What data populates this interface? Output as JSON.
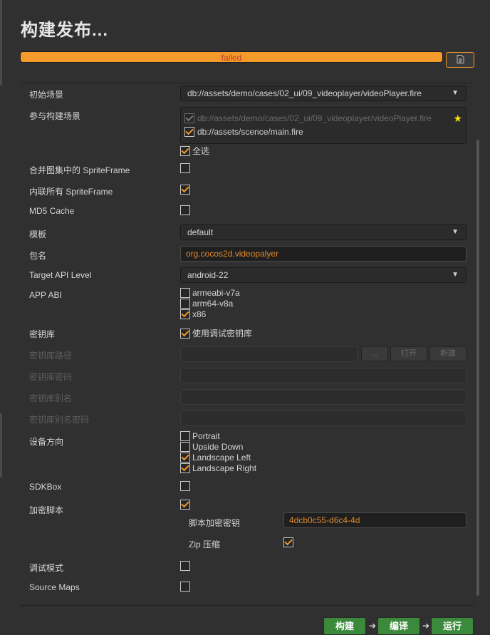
{
  "window": {
    "title": "构建发布..."
  },
  "progress": {
    "value": 1.0,
    "status_text": "failed"
  },
  "icons": {
    "log": "document-icon",
    "star": "star-icon",
    "dropdown": "triangle-down-icon"
  },
  "colors": {
    "accent": "#f39a2b",
    "error_text": "#c0392b",
    "build_button": "#3b8a3b"
  },
  "form": {
    "start_scene": {
      "label": "初始场景",
      "value": "db://assets/demo/cases/02_ui/09_videoplayer/videoPlayer.fire"
    },
    "scenes": {
      "label": "参与构建场景",
      "items": [
        {
          "path": "db://assets/demo/cases/02_ui/09_videoplayer/videoPlayer.fire",
          "checked": true,
          "disabled": true
        },
        {
          "path": "db://assets/scence/main.fire",
          "checked": true,
          "disabled": false
        }
      ],
      "select_all": "全选"
    },
    "merge_spriteframe": {
      "label": "合并图集中的 SpriteFrame",
      "checked": false
    },
    "inline_spriteframe": {
      "label": "内联所有 SpriteFrame",
      "checked": true
    },
    "md5_cache": {
      "label": "MD5 Cache",
      "checked": false
    },
    "template": {
      "label": "模板",
      "value": "default"
    },
    "package_name": {
      "label": "包名",
      "value": "org.cocos2d.videopalyer"
    },
    "target_api": {
      "label": "Target API Level",
      "value": "android-22"
    },
    "app_abi": {
      "label": "APP ABI",
      "options": [
        {
          "name": "armeabi-v7a",
          "checked": false
        },
        {
          "name": "arm64-v8a",
          "checked": false
        },
        {
          "name": "x86",
          "checked": true
        }
      ]
    },
    "keystore": {
      "label": "密钥库",
      "use_debug_label": "使用调试密钥库",
      "use_debug": true
    },
    "keystore_path": {
      "label": "密钥库路径",
      "value": "",
      "browse": "...",
      "open": "打开",
      "new": "新建"
    },
    "keystore_password": {
      "label": "密钥库密码",
      "value": ""
    },
    "keystore_alias": {
      "label": "密钥库别名",
      "value": ""
    },
    "keystore_alias_password": {
      "label": "密钥库别名密码",
      "value": ""
    },
    "orientation": {
      "label": "设备方向",
      "options": [
        {
          "name": "Portrait",
          "checked": false
        },
        {
          "name": "Upside Down",
          "checked": false
        },
        {
          "name": "Landscape Left",
          "checked": true
        },
        {
          "name": "Landscape Right",
          "checked": true
        }
      ]
    },
    "sdkbox": {
      "label": "SDKBox",
      "checked": false
    },
    "encrypt_js": {
      "label": "加密脚本",
      "checked": true
    },
    "encrypt_key": {
      "label": "脚本加密密钥",
      "value": "4dcb0c55-d6c4-4d"
    },
    "zip_compress": {
      "label": "Zip 压缩",
      "checked": true
    },
    "debug_mode": {
      "label": "调试模式",
      "checked": false
    },
    "source_maps": {
      "label": "Source Maps",
      "checked": false
    }
  },
  "actions": {
    "build": "构建",
    "compile": "编译",
    "run": "运行"
  }
}
